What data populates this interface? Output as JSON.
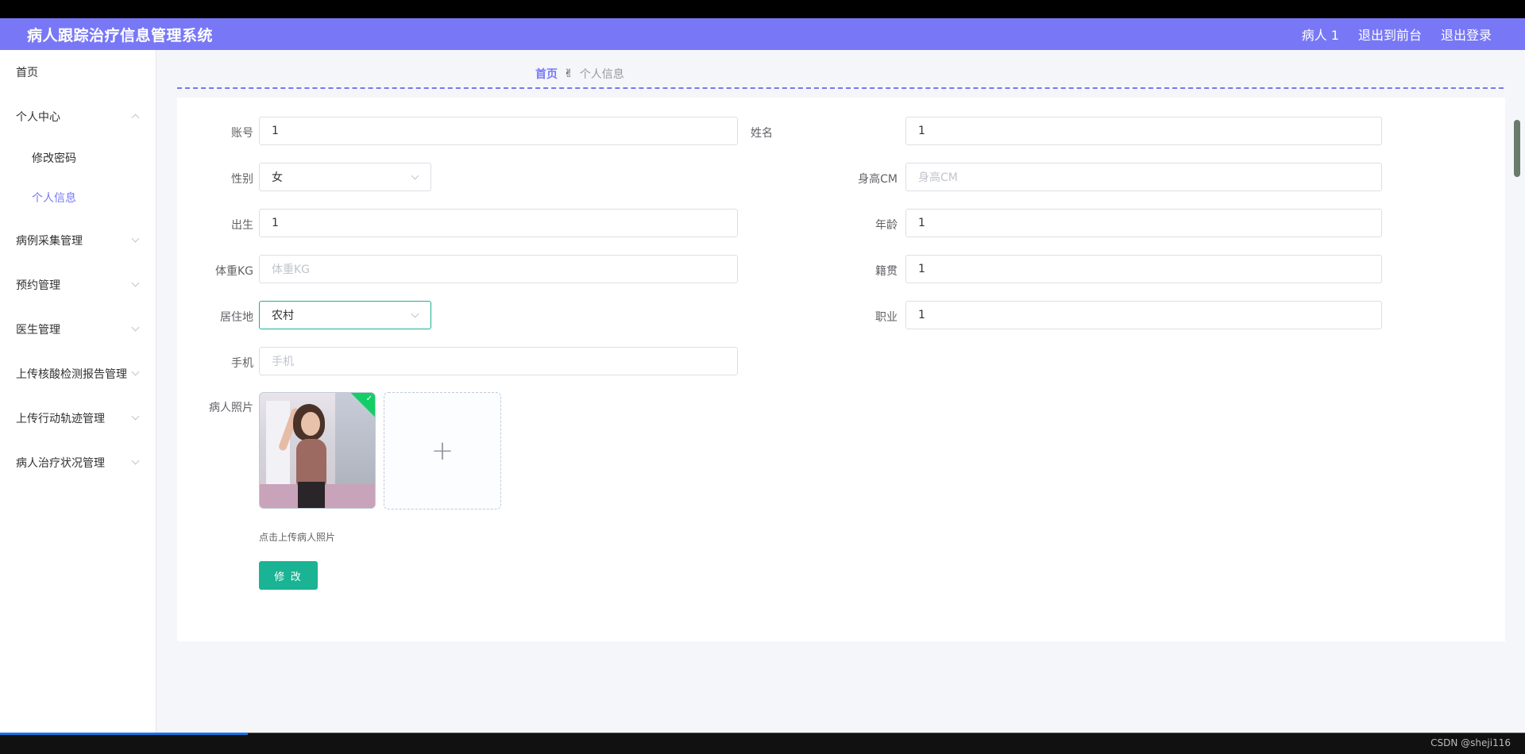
{
  "header": {
    "title": "病人跟踪治疗信息管理系统",
    "user": "病人 1",
    "back_to_front": "退出到前台",
    "logout": "退出登录"
  },
  "sidebar": {
    "items": [
      {
        "label": "首页"
      },
      {
        "label": "个人中心"
      },
      {
        "label": "修改密码"
      },
      {
        "label": "个人信息"
      },
      {
        "label": "病例采集管理"
      },
      {
        "label": "预约管理"
      },
      {
        "label": "医生管理"
      },
      {
        "label": "上传核酸检测报告管理"
      },
      {
        "label": "上传行动轨迹管理"
      },
      {
        "label": "病人治疗状况管理"
      }
    ]
  },
  "breadcrumb": {
    "home": "首页",
    "separator": "✌",
    "current": "个人信息"
  },
  "form": {
    "account": {
      "label": "账号",
      "value": "1"
    },
    "name": {
      "label": "姓名",
      "value": "1"
    },
    "gender": {
      "label": "性别",
      "value": "女"
    },
    "height": {
      "label": "身高CM",
      "placeholder": "身高CM"
    },
    "birth": {
      "label": "出生",
      "value": "1"
    },
    "age": {
      "label": "年龄",
      "value": "1"
    },
    "weight": {
      "label": "体重KG",
      "placeholder": "体重KG"
    },
    "native": {
      "label": "籍贯",
      "value": "1"
    },
    "residence": {
      "label": "居住地",
      "value": "农村"
    },
    "job": {
      "label": "职业",
      "value": "1"
    },
    "phone": {
      "label": "手机",
      "placeholder": "手机"
    },
    "photo": {
      "label": "病人照片",
      "hint": "点击上传病人照片"
    },
    "submit": "修 改"
  },
  "watermark": "CSDN @sheji116",
  "colors": {
    "accent": "#7878f6",
    "primary_button": "#1ab394"
  }
}
